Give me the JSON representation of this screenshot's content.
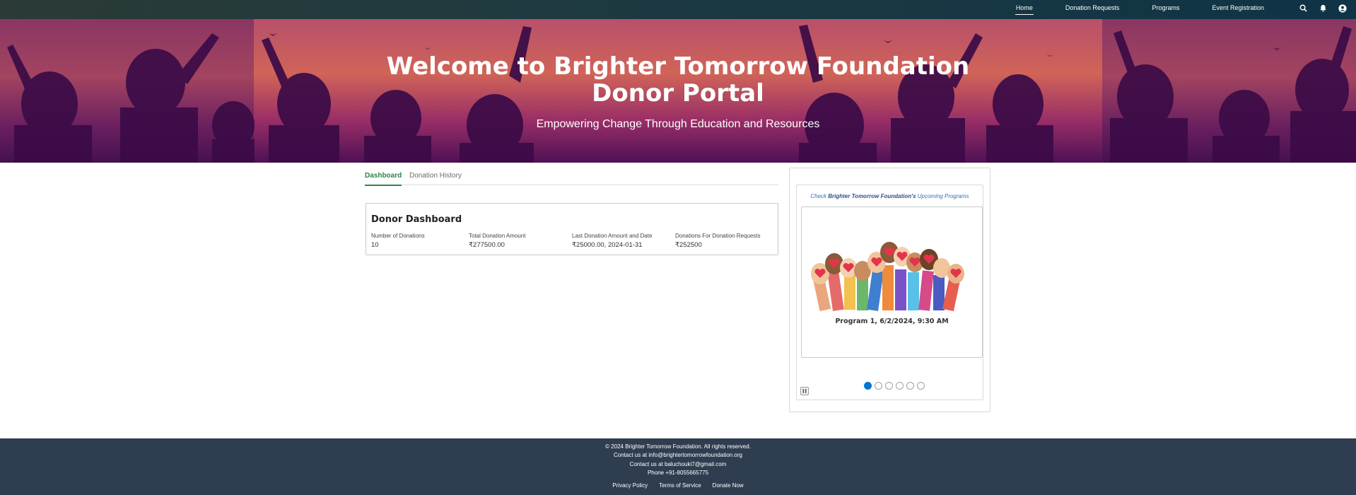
{
  "nav": {
    "items": [
      {
        "label": "Home",
        "active": true
      },
      {
        "label": "Donation Requests"
      },
      {
        "label": "Programs"
      },
      {
        "label": "Event Registration"
      }
    ],
    "icons": [
      "search-icon",
      "bell-icon",
      "user-avatar-icon"
    ]
  },
  "hero": {
    "title_line1": "Welcome to Brighter Tomorrow Foundation",
    "title_line2": "Donor Portal",
    "subtitle": "Empowering Change Through Education and Resources"
  },
  "tabs": [
    {
      "label": "Dashboard",
      "active": true
    },
    {
      "label": "Donation History"
    }
  ],
  "dashboard": {
    "title": "Donor Dashboard",
    "stats": [
      {
        "label": "Number of Donations",
        "value": "10"
      },
      {
        "label": "Total Donation Amount",
        "value": "₹277500.00"
      },
      {
        "label": "Last Donation Amount and Date",
        "value": "₹25000.00, 2024-01-31"
      },
      {
        "label": "Donations For Donation Requests",
        "value": "₹252500"
      }
    ]
  },
  "programs": {
    "caption_prefix": "Check ",
    "caption_org": "Brighter Tomorrow Foundation's",
    "caption_suffix": " Upcoming Programs",
    "slide_caption": "Program 1, 6/2/2024, 9:30 AM",
    "slide_count": 6,
    "active_slide": 1
  },
  "footer": {
    "copyright": "© 2024 Brighter Tomorrow Foundation. All rights reserved.",
    "contact1": "Contact us at info@brightertomorrowfoundation.org",
    "contact2": "Contact us at baluchouki7@gmail.com",
    "phone": "Phone +91-8055665775",
    "links": [
      "Privacy Policy",
      "Terms of Service",
      "Donate Now"
    ]
  },
  "colors": {
    "accent_green": "#2e844a",
    "carousel_blue": "#0176d3",
    "footer_bg": "#2e3e50"
  }
}
